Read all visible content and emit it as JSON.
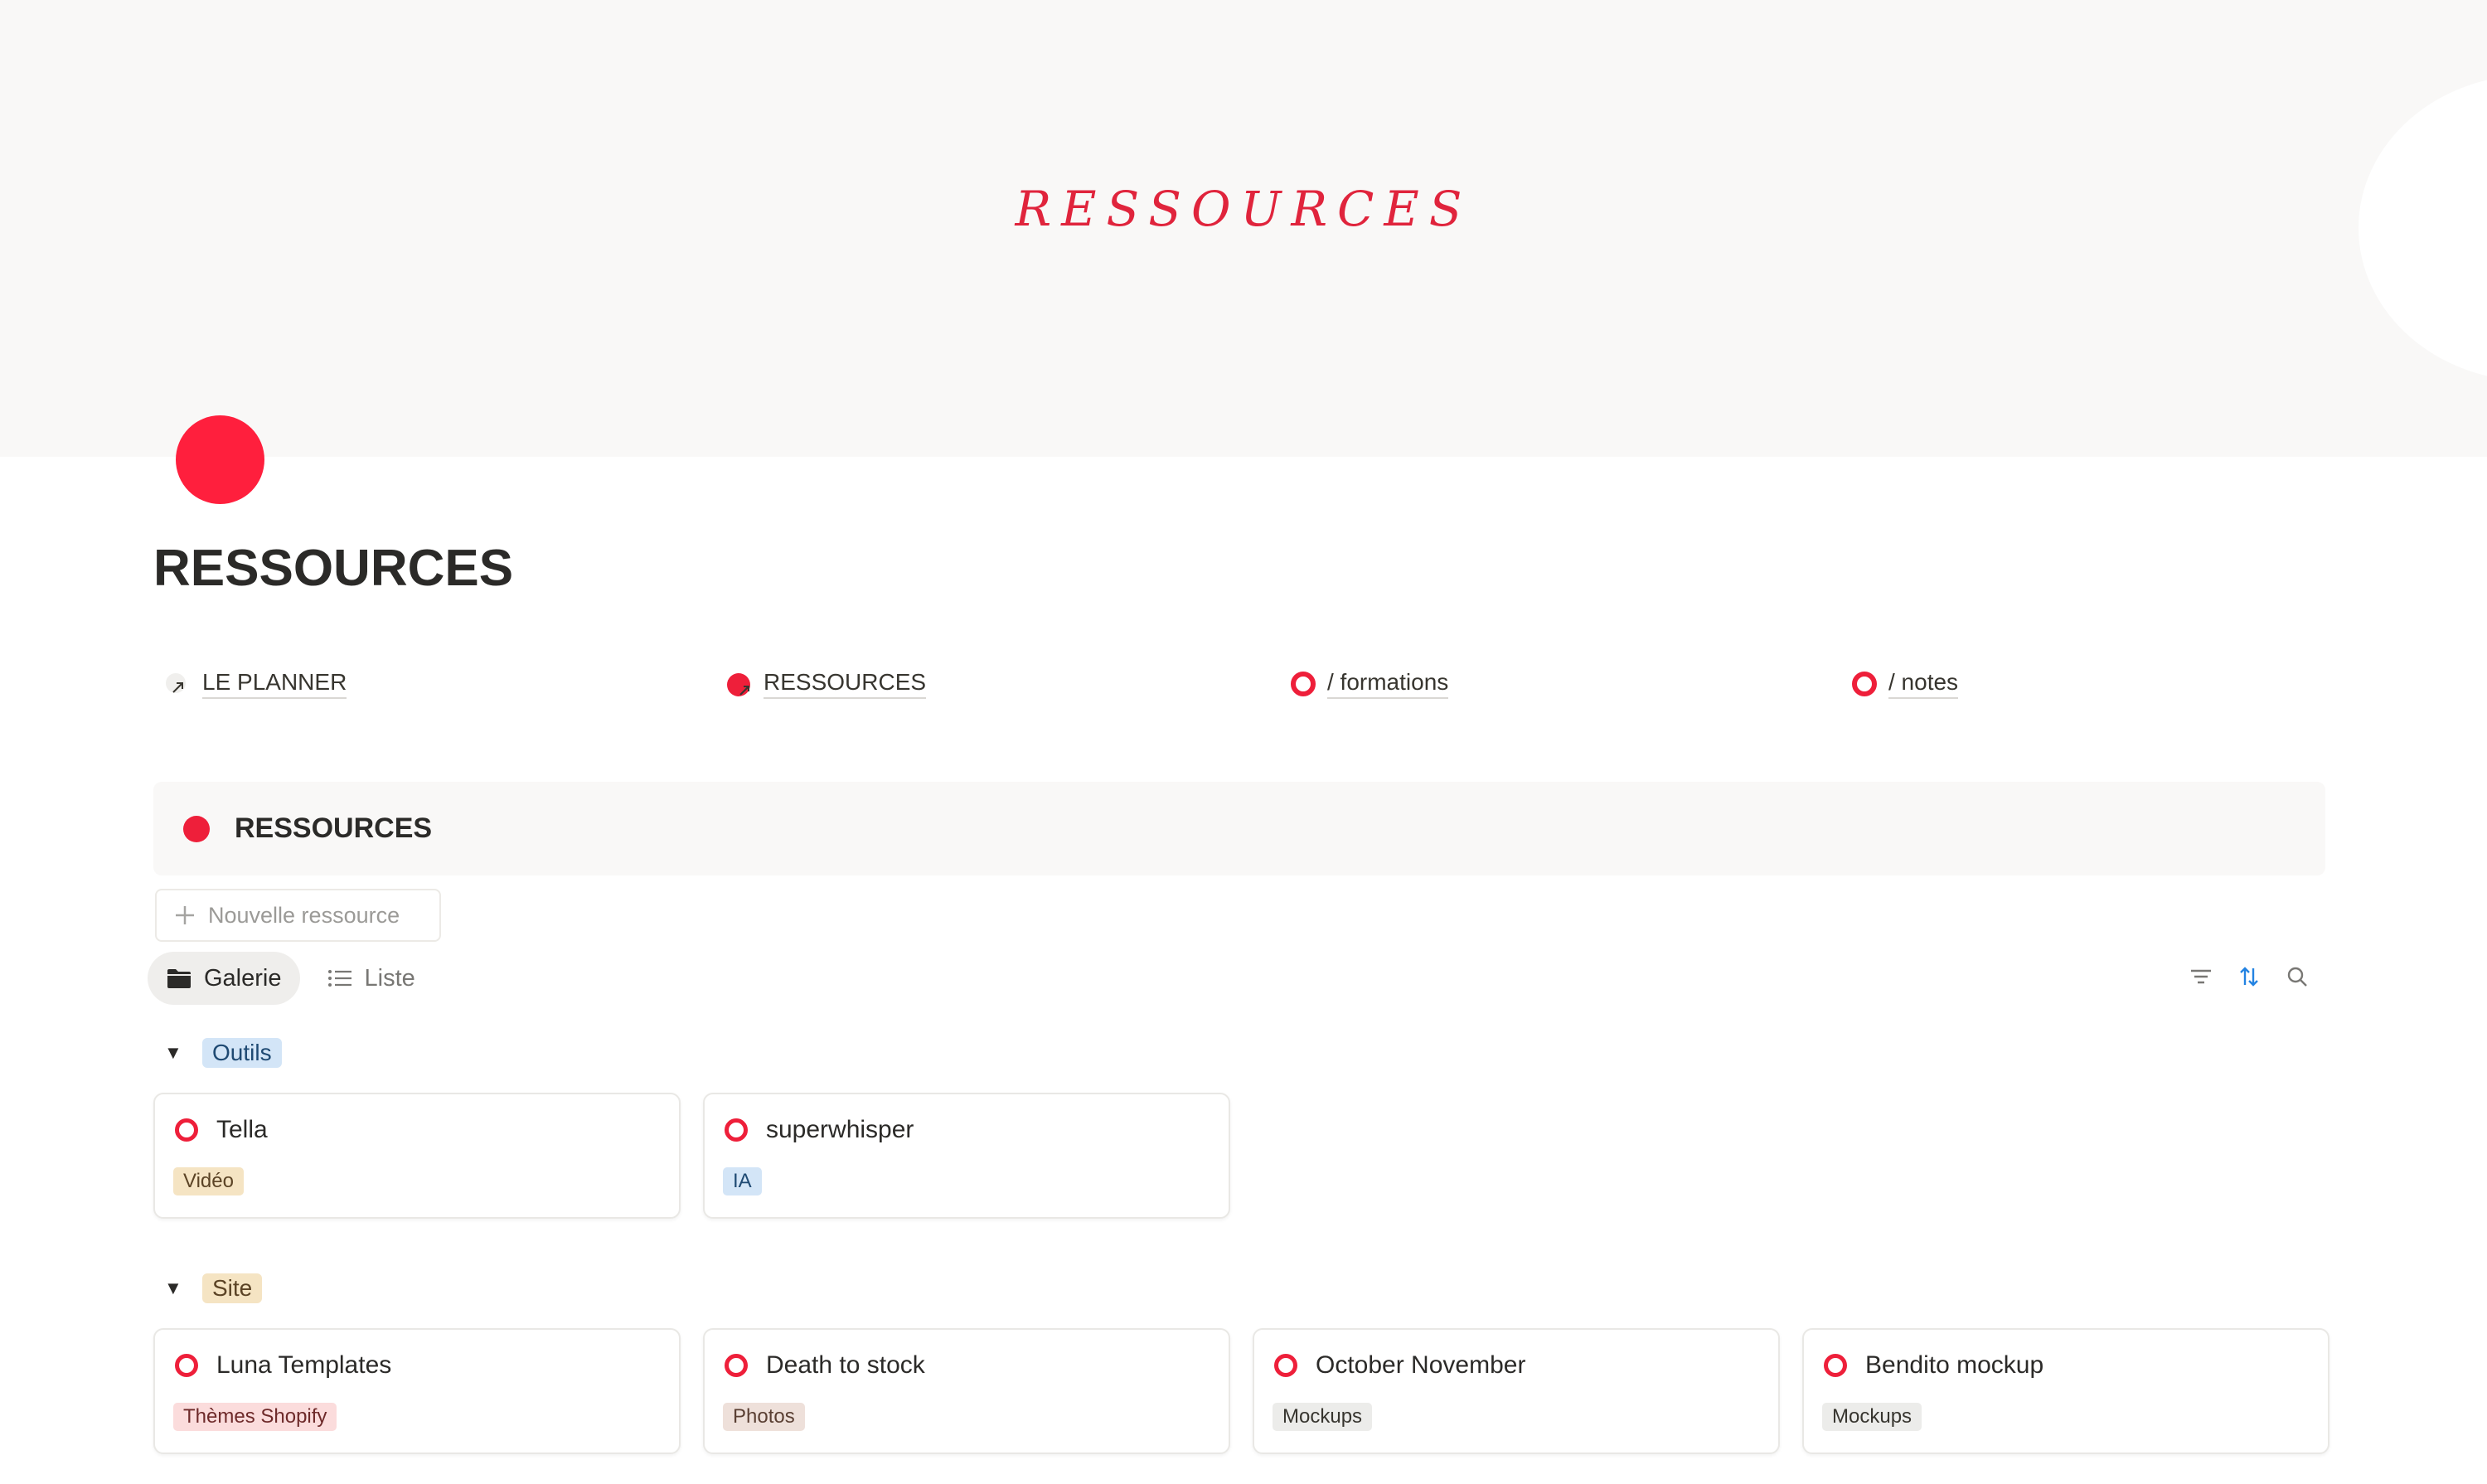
{
  "cover": {
    "title": "RESSOURCES"
  },
  "page": {
    "title": "RESSOURCES"
  },
  "links": [
    {
      "label": "LE PLANNER",
      "icon": "arrow-link-icon"
    },
    {
      "label": "RESSOURCES",
      "icon": "red-dot-link-icon"
    },
    {
      "label": "/ formations",
      "icon": "red-ring-icon"
    },
    {
      "label": "/ notes",
      "icon": "red-ring-icon"
    }
  ],
  "database": {
    "title": "RESSOURCES",
    "new_button": "Nouvelle ressource",
    "views": [
      {
        "label": "Galerie",
        "icon": "folder-icon",
        "active": true
      },
      {
        "label": "Liste",
        "icon": "list-icon",
        "active": false
      }
    ],
    "tools": [
      "filter-icon",
      "sort-icon",
      "search-icon"
    ]
  },
  "groups": [
    {
      "name": "Outils",
      "color": "#d3e5f7",
      "cards": [
        {
          "name": "Tella",
          "tag": "Vidéo",
          "tag_color": "#f5e4c3"
        },
        {
          "name": "superwhisper",
          "tag": "IA",
          "tag_color": "#d3e5f7"
        }
      ]
    },
    {
      "name": "Site",
      "color": "#f5e4c3",
      "cards": [
        {
          "name": "Luna Templates",
          "tag": "Thèmes Shopify",
          "tag_color": "#fbdcdc"
        },
        {
          "name": "Death to stock",
          "tag": "Photos",
          "tag_color": "#eee0da"
        },
        {
          "name": "October November",
          "tag": "Mockups",
          "tag_color": "#ececea"
        },
        {
          "name": "Bendito mockup",
          "tag": "Mockups",
          "tag_color": "#ececea"
        }
      ]
    }
  ],
  "colors": {
    "accent": "#ee1f3a",
    "cover_bg": "#f9f8f7"
  }
}
